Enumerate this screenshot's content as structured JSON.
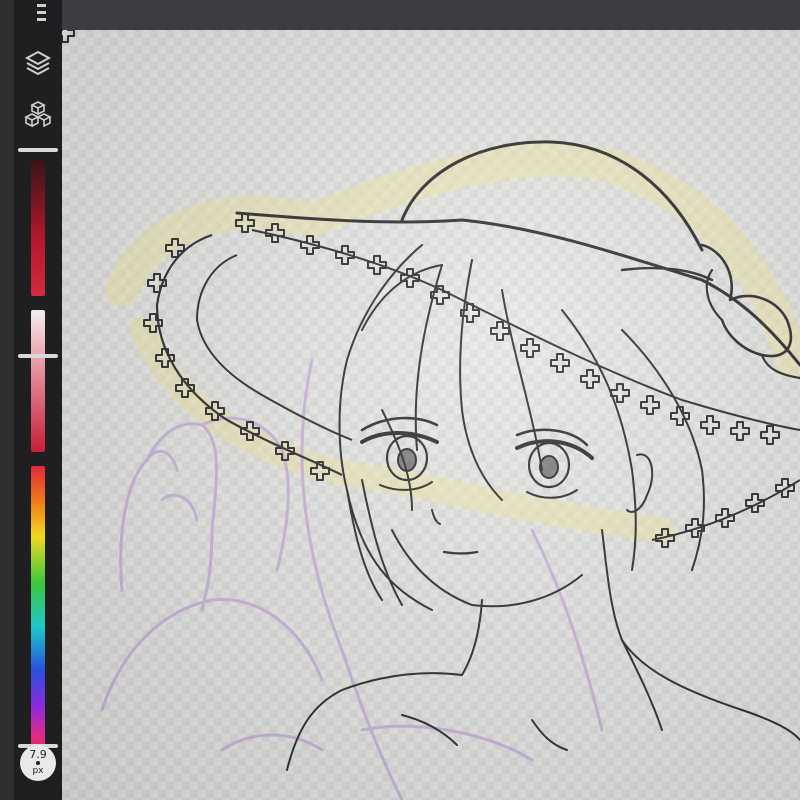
{
  "app": {
    "accent_color": "#d42a3c"
  },
  "toolbar": {
    "menu_icon": "menu-icon",
    "layers_icon": "layers-icon",
    "brush_library_icon": "cubes-icon",
    "brush_size": {
      "value": "7.9",
      "unit": "px"
    },
    "opacity_slider": {
      "level": 0.38
    },
    "hue_slider": {
      "level": 0.97
    }
  },
  "canvas": {
    "background": "transparent-checkerboard",
    "line_color": "#2b2b2b",
    "sketch_color": "#c8b0dc",
    "highlight_color": "#efe7a8"
  }
}
